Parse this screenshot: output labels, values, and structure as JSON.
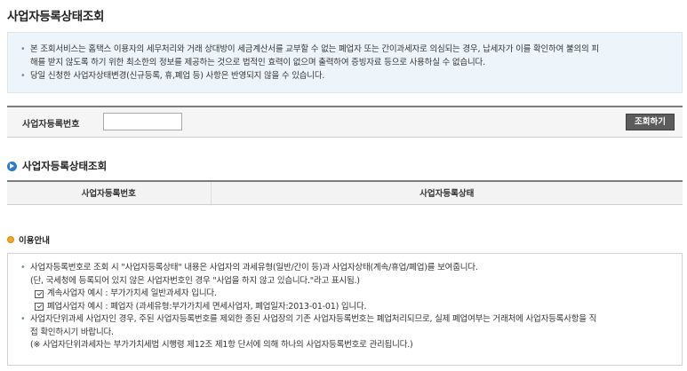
{
  "page": {
    "title": "사업자등록상태조회"
  },
  "notice": {
    "lines": [
      "본 조회서비스는 홈택스 이용자의 세무처리와 거래 상대방이 세금계산서를 교부할 수 없는 폐업자 또는 간이과세자로 의심되는 경우, 납세자가 이를 확인하여 불의의 피",
      "해를 받지 않도록 하기 위한 최소한의 정보를 제공하는 것으로 법적인 효력이 없으며 출력하여 증빙자료 등으로 사용하실 수 없습니다.",
      "당일 신청한 사업자상태변경(신규등록, 휴,폐업 등) 사항은 반영되지 않을 수 있습니다."
    ]
  },
  "search": {
    "label": "사업자등록번호",
    "value": "",
    "button": "조회하기"
  },
  "result": {
    "title": "사업자등록상태조회",
    "columns": [
      "사업자등록번호",
      "사업자등록상태"
    ]
  },
  "guide": {
    "title": "이용안내",
    "lines": [
      "사업자등록번호로 조회 시 \"사업자등록상태\" 내용은 사업자의 과세유형(일반/간이 등)과 사업자상태(계속/휴업/폐업)를 보여줍니다.",
      "(단, 국세청에 등록되어 있지 않은 사업자번호인 경우 \"사업을 하지 않고 있습니다.\"라고 표시됨.)",
      "계속사업자 예시 : 부가가치세 일반과세자 입니다.",
      "폐업사업자 예시 : 폐업자 (과세유형:부가가치세 면세사업자, 폐업일자:2013-01-01) 입니다.",
      "사업자단위과세 사업자인 경우, 주된 사업자등록번호를 제외한 종된 사업장의 기존 사업자등록번호는 폐업처리되므로, 실제 폐업여부는 거래처에 사업자등록사항을 직",
      "접 확인하시기 바랍니다.",
      "(※ 사업자단위과세자는 부가가치세법 시행령 제12조 제1항 단서에 의해 하나의 사업자등록번호로 관리됩니다.)"
    ]
  },
  "colors": {
    "accent": "#2b7dc6",
    "notice_bg": "#eef5fa",
    "button": "#5c5c5c",
    "guide_dot": "#f4a426"
  },
  "icons": {
    "section": "circle-arrow-icon",
    "guide": "orange-dot-icon",
    "example": "check-box-icon"
  }
}
